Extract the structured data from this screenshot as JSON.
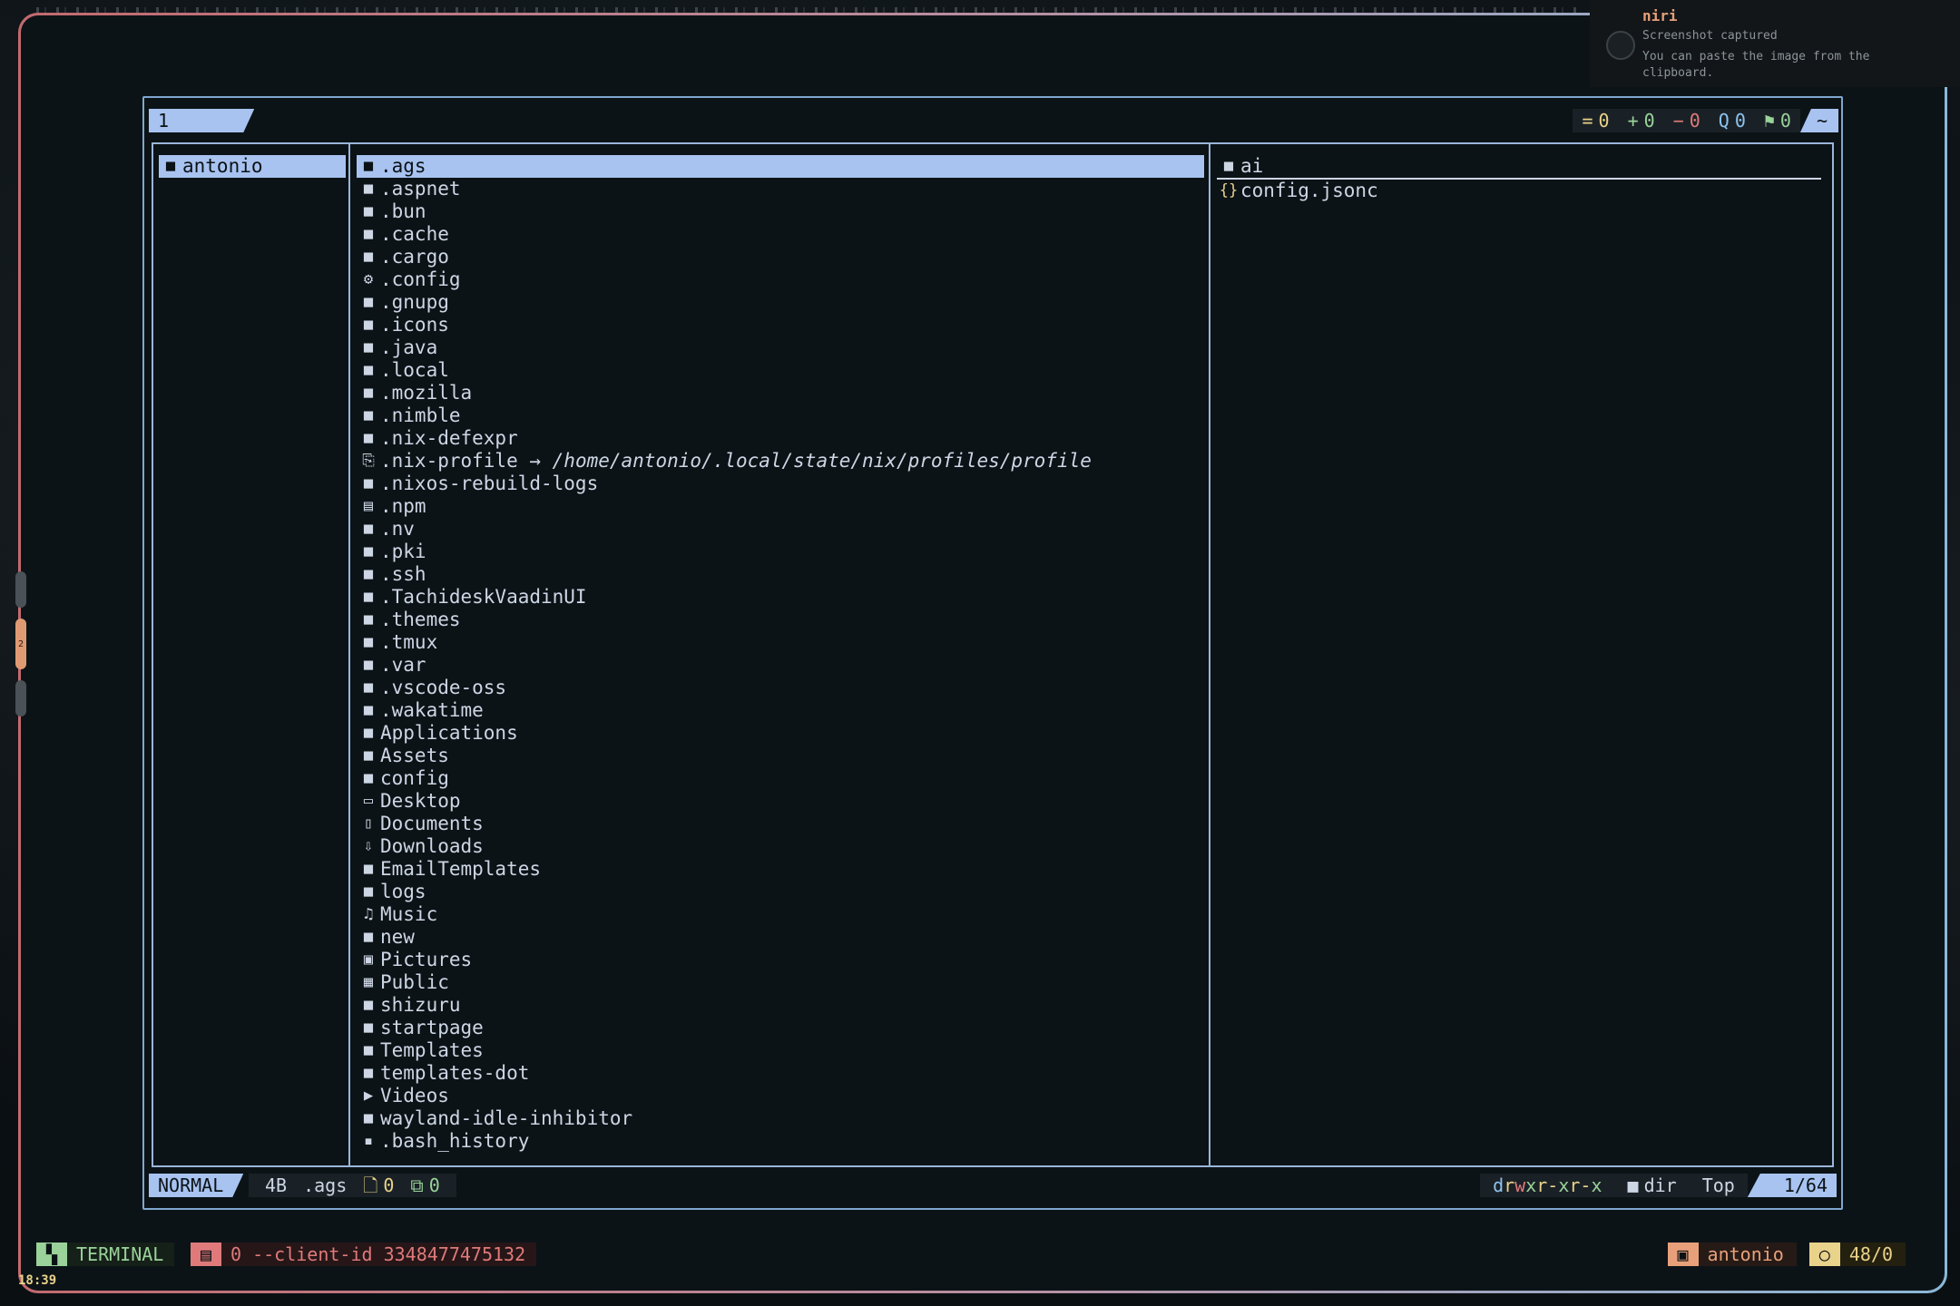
{
  "notification": {
    "app": "niri",
    "title": "Screenshot captured",
    "body": "You can paste the image from the clipboard."
  },
  "workspaces": {
    "active_label": "2"
  },
  "tabline": {
    "tab_label": "1 antonio",
    "stats": [
      {
        "icon": "=",
        "value": "0",
        "color": "#e9d28a"
      },
      {
        "icon": "+",
        "value": "0",
        "color": "#9ad29a"
      },
      {
        "icon": "−",
        "value": "0",
        "color": "#e07a7a"
      },
      {
        "icon": "Q",
        "value": "0",
        "color": "#8ec3f0"
      },
      {
        "icon": "⚑",
        "value": "0",
        "color": "#9ad29a"
      }
    ],
    "cwd_short": "~"
  },
  "parent_pane": {
    "items": [
      {
        "icon": "folder-icon",
        "glyph": "■",
        "name": "antonio"
      }
    ]
  },
  "current_pane": {
    "items": [
      {
        "glyph": "■",
        "name": ".ags"
      },
      {
        "glyph": "■",
        "name": ".aspnet"
      },
      {
        "glyph": "■",
        "name": ".bun"
      },
      {
        "glyph": "■",
        "name": ".cache"
      },
      {
        "glyph": "■",
        "name": ".cargo"
      },
      {
        "glyph": "⚙",
        "name": ".config"
      },
      {
        "glyph": "■",
        "name": ".gnupg"
      },
      {
        "glyph": "■",
        "name": ".icons"
      },
      {
        "glyph": "■",
        "name": ".java"
      },
      {
        "glyph": "■",
        "name": ".local"
      },
      {
        "glyph": "■",
        "name": ".mozilla"
      },
      {
        "glyph": "■",
        "name": ".nimble"
      },
      {
        "glyph": "■",
        "name": ".nix-defexpr"
      },
      {
        "glyph": "⎘",
        "name": ".nix-profile",
        "link": " → ",
        "target": "/home/antonio/.local/state/nix/profiles/profile"
      },
      {
        "glyph": "■",
        "name": ".nixos-rebuild-logs"
      },
      {
        "glyph": "▤",
        "name": ".npm"
      },
      {
        "glyph": "■",
        "name": ".nv"
      },
      {
        "glyph": "■",
        "name": ".pki"
      },
      {
        "glyph": "■",
        "name": ".ssh"
      },
      {
        "glyph": "■",
        "name": ".TachideskVaadinUI"
      },
      {
        "glyph": "■",
        "name": ".themes"
      },
      {
        "glyph": "■",
        "name": ".tmux"
      },
      {
        "glyph": "■",
        "name": ".var"
      },
      {
        "glyph": "■",
        "name": ".vscode-oss"
      },
      {
        "glyph": "■",
        "name": ".wakatime"
      },
      {
        "glyph": "■",
        "name": "Applications"
      },
      {
        "glyph": "■",
        "name": "Assets"
      },
      {
        "glyph": "■",
        "name": "config"
      },
      {
        "glyph": "▭",
        "name": "Desktop"
      },
      {
        "glyph": "▯",
        "name": "Documents"
      },
      {
        "glyph": "⇩",
        "name": "Downloads"
      },
      {
        "glyph": "■",
        "name": "EmailTemplates"
      },
      {
        "glyph": "■",
        "name": "logs"
      },
      {
        "glyph": "♫",
        "name": "Music"
      },
      {
        "glyph": "■",
        "name": "new"
      },
      {
        "glyph": "▣",
        "name": "Pictures"
      },
      {
        "glyph": "▦",
        "name": "Public"
      },
      {
        "glyph": "■",
        "name": "shizuru"
      },
      {
        "glyph": "■",
        "name": "startpage"
      },
      {
        "glyph": "■",
        "name": "Templates"
      },
      {
        "glyph": "■",
        "name": "templates-dot"
      },
      {
        "glyph": "▶",
        "name": "Videos"
      },
      {
        "glyph": "■",
        "name": "wayland-idle-inhibitor"
      },
      {
        "glyph": "▪",
        "name": ".bash_history"
      }
    ],
    "selected_index": 0
  },
  "preview_pane": {
    "items": [
      {
        "glyph": "■",
        "name": "ai",
        "color": "#cdd6e4"
      },
      {
        "glyph": "{}",
        "name": "config.jsonc",
        "color": "#e9d28a"
      }
    ]
  },
  "statusline": {
    "mode": "NORMAL",
    "size": "4B",
    "name": ".ags",
    "files_icon": "🗋",
    "files_count": "0",
    "copied_icon": "⧉",
    "copied_count": "0",
    "perm": {
      "d": "d",
      "r1": "r",
      "w1": "w",
      "x1": "x",
      "r2": "r-",
      "x2": "x",
      "r3": "r-",
      "x3": "x"
    },
    "type_glyph": "■",
    "type": "dir",
    "scroll": "Top",
    "position": "1/64"
  },
  "tmux": {
    "terminal_label": "TERMINAL",
    "client_label": "0 --client-id 3348477475132",
    "user": "antonio",
    "load": "48/0",
    "clock": "18:39"
  }
}
